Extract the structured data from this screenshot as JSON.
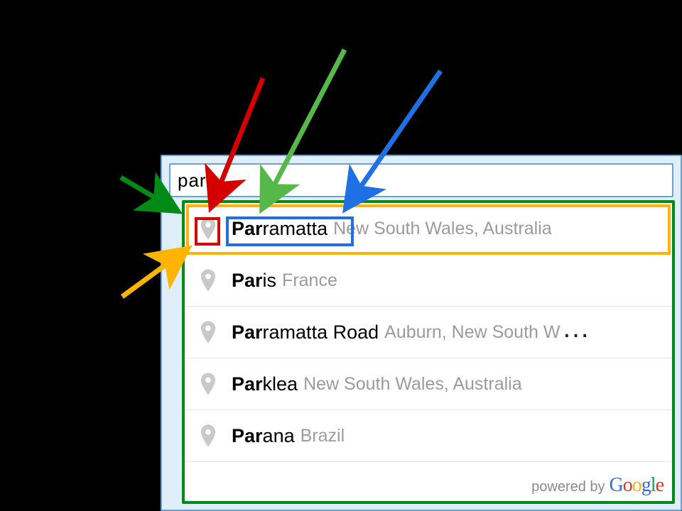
{
  "search": {
    "value": "par",
    "placeholder": ""
  },
  "suggestions": [
    {
      "match": "Par",
      "rest": "ramatta",
      "sub": "New South Wales, Australia"
    },
    {
      "match": "Par",
      "rest": "is",
      "sub": "France"
    },
    {
      "match": "Par",
      "rest": "ramatta Road",
      "sub": "Auburn, New South W",
      "truncated": true
    },
    {
      "match": "Par",
      "rest": "klea",
      "sub": "New South Wales, Australia"
    },
    {
      "match": "Par",
      "rest": "ana",
      "sub": "Brazil"
    }
  ],
  "footer": {
    "prefix": "powered by",
    "brand_letters": [
      "G",
      "o",
      "o",
      "g",
      "l",
      "e"
    ]
  },
  "annotations": {
    "arrow_colors": {
      "dropdown_box": "#008b17",
      "row_highlight": "#ffb400",
      "pin_highlight": "#d40000",
      "match_text_highlight": "#56b84a",
      "full_text_highlight": "#1f6fe5"
    }
  }
}
